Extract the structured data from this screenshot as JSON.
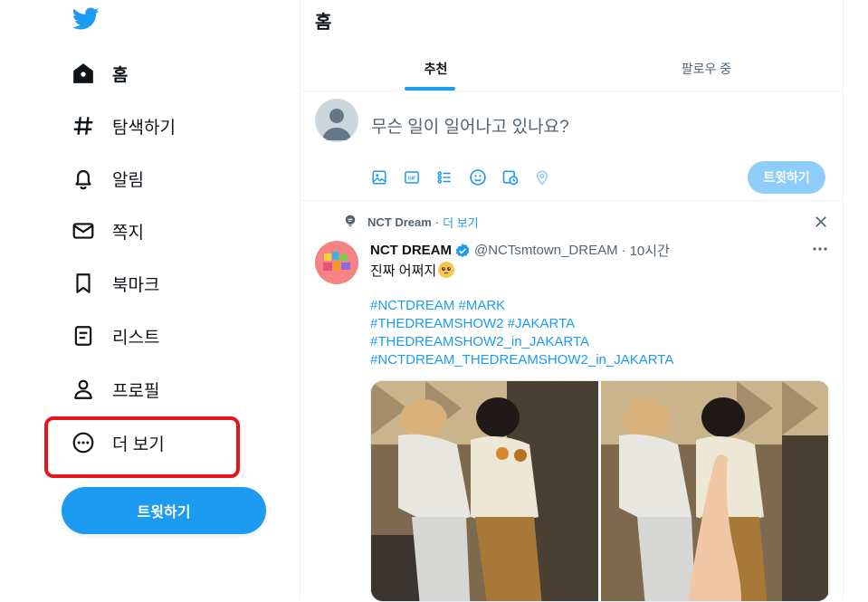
{
  "sidebar": {
    "nav": [
      {
        "label": "홈"
      },
      {
        "label": "탐색하기"
      },
      {
        "label": "알림"
      },
      {
        "label": "쪽지"
      },
      {
        "label": "북마크"
      },
      {
        "label": "리스트"
      },
      {
        "label": "프로필"
      },
      {
        "label": "더 보기"
      }
    ],
    "tweet_button": "트윗하기",
    "icons": [
      "twitter-logo-icon",
      "home-icon",
      "hashtag-icon",
      "bell-icon",
      "mail-icon",
      "bookmark-icon",
      "list-icon",
      "person-icon",
      "more-circle-icon"
    ]
  },
  "header": {
    "title": "홈"
  },
  "tabs": [
    {
      "label": "추천",
      "selected": true
    },
    {
      "label": "팔로우 중",
      "selected": false
    }
  ],
  "compose": {
    "placeholder": "무슨 일이 일어나고 있나요?",
    "button": "트윗하기",
    "tools": [
      "image-icon",
      "gif-icon",
      "poll-icon",
      "emoji-icon",
      "schedule-icon",
      "location-icon"
    ]
  },
  "tweet": {
    "context_name": "NCT Dream",
    "context_sep": "·",
    "context_more": "더 보기",
    "author": "NCT DREAM",
    "handle": "@NCTsmtown_DREAM",
    "sep": "·",
    "time": "10시간",
    "text": "진짜 어쩌지",
    "hashtags": [
      "#NCTDREAM #MARK",
      "#THEDREAMSHOW2 #JAKARTA",
      "#THEDREAMSHOW2_in_JAKARTA",
      "#NCTDREAM_THEDREAMSHOW2_in_JAKARTA"
    ]
  },
  "colors": {
    "accent": "#1d9bf0",
    "highlight": "#e8141a",
    "muted": "#536471"
  }
}
